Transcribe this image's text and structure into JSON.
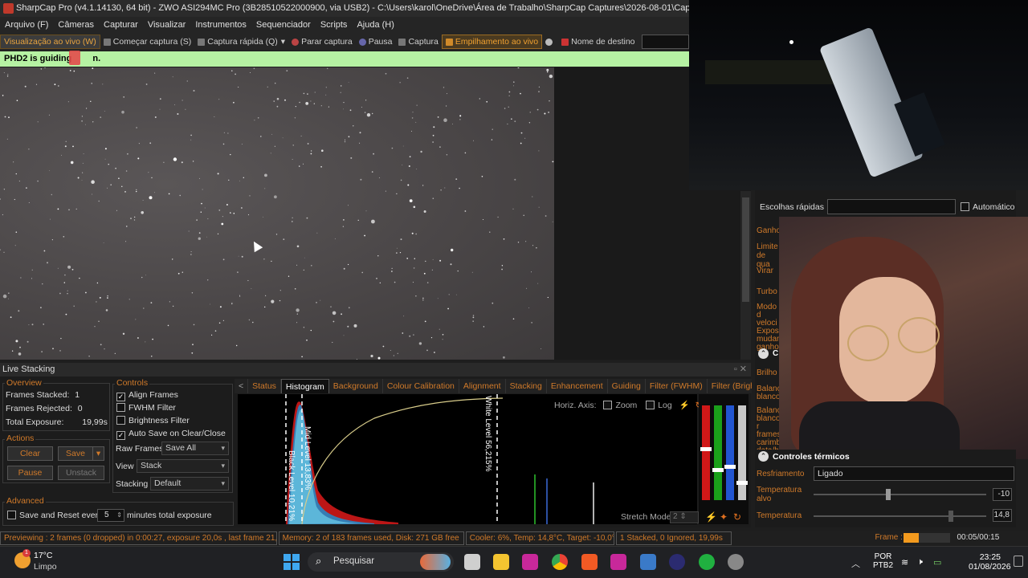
{
  "window": {
    "title": "SharpCap Pro (v4.1.14130, 64 bit) - ZWO ASI294MC Pro (3B28510522000900, via USB2) - C:\\Users\\karol\\OneDrive\\Área de Trabalho\\SharpCap Captures\\2026-08-01\\Capture\\23_06_34\\Captur"
  },
  "menu": [
    "Arquivo (F)",
    "Câmeras",
    "Capturar",
    "Visualizar",
    "Instrumentos",
    "Sequenciador",
    "Scripts",
    "Ajuda (H)"
  ],
  "toolbar": {
    "live_view": "Visualização ao vivo (W)",
    "start_capture": "Começar captura (S)",
    "quick_capture": "Captura rápida (Q)",
    "stop_capture": "Parar captura",
    "pause": "Pausa",
    "capture": "Captura",
    "live_stacking": "Empilhamento ao vivo",
    "target_name": "Nome de destino"
  },
  "guiding_banner": "PHD2 is guiding",
  "guiding_banner_tail": "n.",
  "right_panel": {
    "quick_choices": "Escolhas rápidas",
    "automatic": "Automático",
    "labels": [
      "Ganho",
      "Limite de qua",
      "Virar",
      "Turbo U",
      "Modo d veloci Exposi mudan ganho",
      "Brilho",
      "Balanç blanco",
      "Balanç blanco r frames carimb data/ho"
    ],
    "controls_section": "C",
    "thermal_title": "Controles térmicos",
    "cooling_label": "Resfriamento",
    "cooling_value": "Ligado",
    "target_temp_label": "Temperatura alvo",
    "target_temp_value": "-10",
    "temp_label": "Temperatura",
    "temp_value": "14,8"
  },
  "live_stacking": {
    "title": "Live Stacking",
    "overview_title": "Overview",
    "frames_stacked_label": "Frames Stacked:",
    "frames_stacked": "1",
    "frames_rejected_label": "Frames Rejected:",
    "frames_rejected": "0",
    "total_exposure_label": "Total Exposure:",
    "total_exposure": "19,99s",
    "controls_title": "Controls",
    "align_frames": "Align Frames",
    "fwhm_filter": "FWHM Filter",
    "brightness_filter": "Brightness Filter",
    "auto_save": "Auto Save on Clear/Close",
    "raw_frames_label": "Raw Frames",
    "raw_frames_value": "Save All",
    "view_label": "View",
    "view_value": "Stack",
    "stacking_label": "Stacking",
    "stacking_value": "Default",
    "actions_title": "Actions",
    "clear": "Clear",
    "save": "Save",
    "pause": "Pause",
    "unstack": "Unstack",
    "advanced_title": "Advanced",
    "save_reset_label": "Save and Reset every",
    "save_reset_value": "5",
    "minutes_label": "minutes total exposure",
    "tabs": [
      "Status",
      "Histogram",
      "Background",
      "Colour Calibration",
      "Alignment",
      "Stacking",
      "Enhancement",
      "Guiding",
      "Filter (FWHM)",
      "Filter (Brightness)"
    ],
    "selected_tab": "Histogram",
    "horiz_axis": "Horiz. Axis:",
    "zoom": "Zoom",
    "log": "Log",
    "stretch_mode": "Stretch Mode",
    "black_level": "Black Level 10,21%",
    "mid_level": "Mid Level 13,83%",
    "white_level": "White Level 56,215%"
  },
  "status_bar": {
    "preview": "Previewing : 2 frames (0 dropped) in 0:00:27, exposure 20,0s , last frame 21,0s",
    "memory": "Memory: 2 of 183 frames used, Disk: 271 GB free",
    "cooler": "Cooler: 6%, Temp: 14,8°C, Target: -10,0°C",
    "stacked": "1 Stacked, 0 Ignored, 19,99s",
    "frame_label": "Frame :",
    "time": "00:05/00:15"
  },
  "taskbar": {
    "weather_temp": "17°C",
    "weather_desc": "Limpo",
    "search": "Pesquisar",
    "lang1": "POR",
    "lang2": "PTB2",
    "clock_time": "23:25",
    "clock_date": "01/08/2026"
  }
}
